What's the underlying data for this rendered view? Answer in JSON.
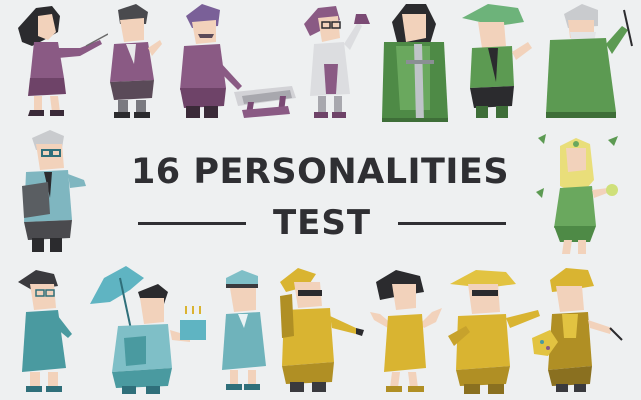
{
  "title": {
    "main": "16 PERSONALITIES",
    "sub": "TEST"
  },
  "colors": {
    "background": "#eef0f1",
    "title_text": "#2f2f33",
    "analysts_purple": "#8a5a84",
    "diplomats_green": "#5c9a52",
    "sentinels_teal": "#4a9aa0",
    "explorers_yellow": "#d9b431"
  },
  "figures": [
    {
      "name": "analyst-architect-figure",
      "group": "analysts"
    },
    {
      "name": "analyst-logician-figure",
      "group": "analysts"
    },
    {
      "name": "analyst-commander-figure",
      "group": "analysts"
    },
    {
      "name": "analyst-debater-figure",
      "group": "analysts"
    },
    {
      "name": "diplomat-advocate-figure",
      "group": "diplomats"
    },
    {
      "name": "diplomat-mediator-figure",
      "group": "diplomats"
    },
    {
      "name": "diplomat-protagonist-figure",
      "group": "diplomats"
    },
    {
      "name": "diplomat-campaigner-figure",
      "group": "diplomats"
    },
    {
      "name": "sentinel-logistician-figure",
      "group": "sentinels"
    },
    {
      "name": "sentinel-defender-figure",
      "group": "sentinels"
    },
    {
      "name": "sentinel-executive-figure",
      "group": "sentinels"
    },
    {
      "name": "sentinel-consul-figure",
      "group": "sentinels"
    },
    {
      "name": "explorer-virtuoso-figure",
      "group": "explorers"
    },
    {
      "name": "explorer-adventurer-figure",
      "group": "explorers"
    },
    {
      "name": "explorer-entrepreneur-figure",
      "group": "explorers"
    },
    {
      "name": "explorer-entertainer-figure",
      "group": "explorers"
    }
  ]
}
